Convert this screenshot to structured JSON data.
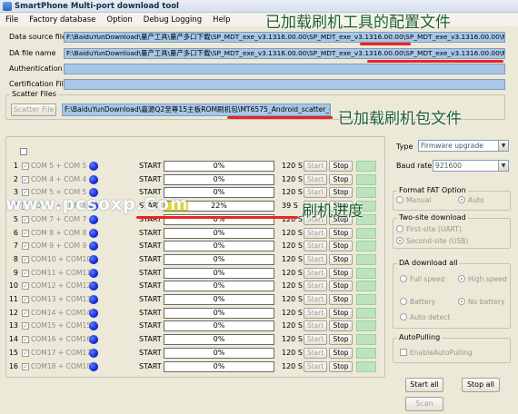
{
  "window": {
    "title": "SmartPhone Multi-port download tool"
  },
  "menu": [
    "File",
    "Factory database",
    "Option",
    "Debug Logging",
    "Help"
  ],
  "fields": {
    "da_source_label": "Data source file",
    "da_source_value": "F:\\BaiduYunDownload\\量产工具\\量产多口下载\\SP_MDT_exe_v3.1316.00.00\\SP_MDT_exe_v3.1316.00.00\\SP_MDT_exe_v3.1316.00.00\\MTK_DA",
    "da_file_label": "DA file name",
    "da_file_value": "F:\\BaiduYunDownload\\量产工具\\量产多口下载\\SP_MDT_exe_v3.1316.00.00\\SP_MDT_exe_v3.1316.00.00\\SP_MDT_exe_v3.1316.00.00\\MTK_AllIn",
    "auth_label": "Authentication File",
    "auth_value": "",
    "cert_label": "Certification File",
    "cert_value": ""
  },
  "scatter": {
    "group_label": "Scatter Files",
    "button_label": "Scatter File",
    "path": "F:\\BaiduYunDownload\\嘉源Q2至尊15主板ROM刷机包\\MT6575_Android_scatter_emmc.txt"
  },
  "annotations": {
    "config_loaded": "已加载刷机工具的配置文件",
    "package_loaded": "已加载刷机包文件",
    "progress": "刷机进度"
  },
  "watermark": "www.pcsoxp.Com",
  "ports": [
    {
      "num": "1",
      "com": "COM 5 + COM 5",
      "start": "START",
      "pct": "0%",
      "progress": 0,
      "time": "120 S",
      "start_btn": "Start",
      "stop_btn": "Stop"
    },
    {
      "num": "2",
      "com": "COM 4 + COM 4",
      "start": "START",
      "pct": "0%",
      "progress": 0,
      "time": "120 S",
      "start_btn": "Start",
      "stop_btn": "Stop"
    },
    {
      "num": "3",
      "com": "COM 5 + COM 5",
      "start": "START",
      "pct": "0%",
      "progress": 0,
      "time": "120 S",
      "start_btn": "Start",
      "stop_btn": "Stop"
    },
    {
      "num": "4",
      "com": "COM 6 + COM 6",
      "start": "START",
      "pct": "22%",
      "progress": 0.22,
      "time": "39 S",
      "start_btn": "Start",
      "stop_btn": "Stop"
    },
    {
      "num": "5",
      "com": "COM 7 + COM 7",
      "start": "START",
      "pct": "0%",
      "progress": 0,
      "time": "120 S",
      "start_btn": "Start",
      "stop_btn": "Stop"
    },
    {
      "num": "6",
      "com": "COM 8 + COM 8",
      "start": "START",
      "pct": "0%",
      "progress": 0,
      "time": "120 S",
      "start_btn": "Start",
      "stop_btn": "Stop"
    },
    {
      "num": "7",
      "com": "COM 9 + COM 9",
      "start": "START",
      "pct": "0%",
      "progress": 0,
      "time": "120 S",
      "start_btn": "Start",
      "stop_btn": "Stop"
    },
    {
      "num": "8",
      "com": "COM10 + COM10",
      "start": "START",
      "pct": "0%",
      "progress": 0,
      "time": "120 S",
      "start_btn": "Start",
      "stop_btn": "Stop"
    },
    {
      "num": "9",
      "com": "COM11 + COM11",
      "start": "START",
      "pct": "0%",
      "progress": 0,
      "time": "120 S",
      "start_btn": "Start",
      "stop_btn": "Stop"
    },
    {
      "num": "10",
      "com": "COM12 + COM12",
      "start": "START",
      "pct": "0%",
      "progress": 0,
      "time": "120 S",
      "start_btn": "Start",
      "stop_btn": "Stop"
    },
    {
      "num": "11",
      "com": "COM13 + COM13",
      "start": "START",
      "pct": "0%",
      "progress": 0,
      "time": "120 S",
      "start_btn": "Start",
      "stop_btn": "Stop"
    },
    {
      "num": "12",
      "com": "COM14 + COM14",
      "start": "START",
      "pct": "0%",
      "progress": 0,
      "time": "120 S",
      "start_btn": "Start",
      "stop_btn": "Stop"
    },
    {
      "num": "13",
      "com": "COM15 + COM15",
      "start": "START",
      "pct": "0%",
      "progress": 0,
      "time": "120 S",
      "start_btn": "Start",
      "stop_btn": "Stop"
    },
    {
      "num": "14",
      "com": "COM16 + COM16",
      "start": "START",
      "pct": "0%",
      "progress": 0,
      "time": "120 S",
      "start_btn": "Start",
      "stop_btn": "Stop"
    },
    {
      "num": "15",
      "com": "COM17 + COM17",
      "start": "START",
      "pct": "0%",
      "progress": 0,
      "time": "120 S",
      "start_btn": "Start",
      "stop_btn": "Stop"
    },
    {
      "num": "16",
      "com": "COM18 + COM18",
      "start": "START",
      "pct": "0%",
      "progress": 0,
      "time": "120 S",
      "start_btn": "Start",
      "stop_btn": "Stop"
    }
  ],
  "settings": {
    "type_label": "Type",
    "type_value": "Firmware upgrade",
    "baud_label": "Baud rate",
    "baud_value": "921600",
    "fat_group": "Format FAT Option",
    "fat_manual": "Manual",
    "fat_auto": "Auto",
    "twosite_group": "Two-site download",
    "twosite_first": "First-site (UART)",
    "twosite_second": "Second-site (USB)",
    "da_group": "DA download all",
    "da_full": "Full speed",
    "da_high": "High speed",
    "da_battery": "Battery",
    "da_nobattery": "No battery",
    "da_autodetect": "Auto detect",
    "autopulling_group": "AutoPulling",
    "autopulling_enable": "EnableAutoPulling"
  },
  "actions": {
    "start_all": "Start all",
    "stop_all": "Stop all",
    "scan": "Scan"
  },
  "colors": {
    "field_bg": "#a8c7e8",
    "progress_fill": "#f2e200",
    "status_green": "#bde3be",
    "annotation_green": "#1a5e2a",
    "underline_red": "#e22222"
  }
}
